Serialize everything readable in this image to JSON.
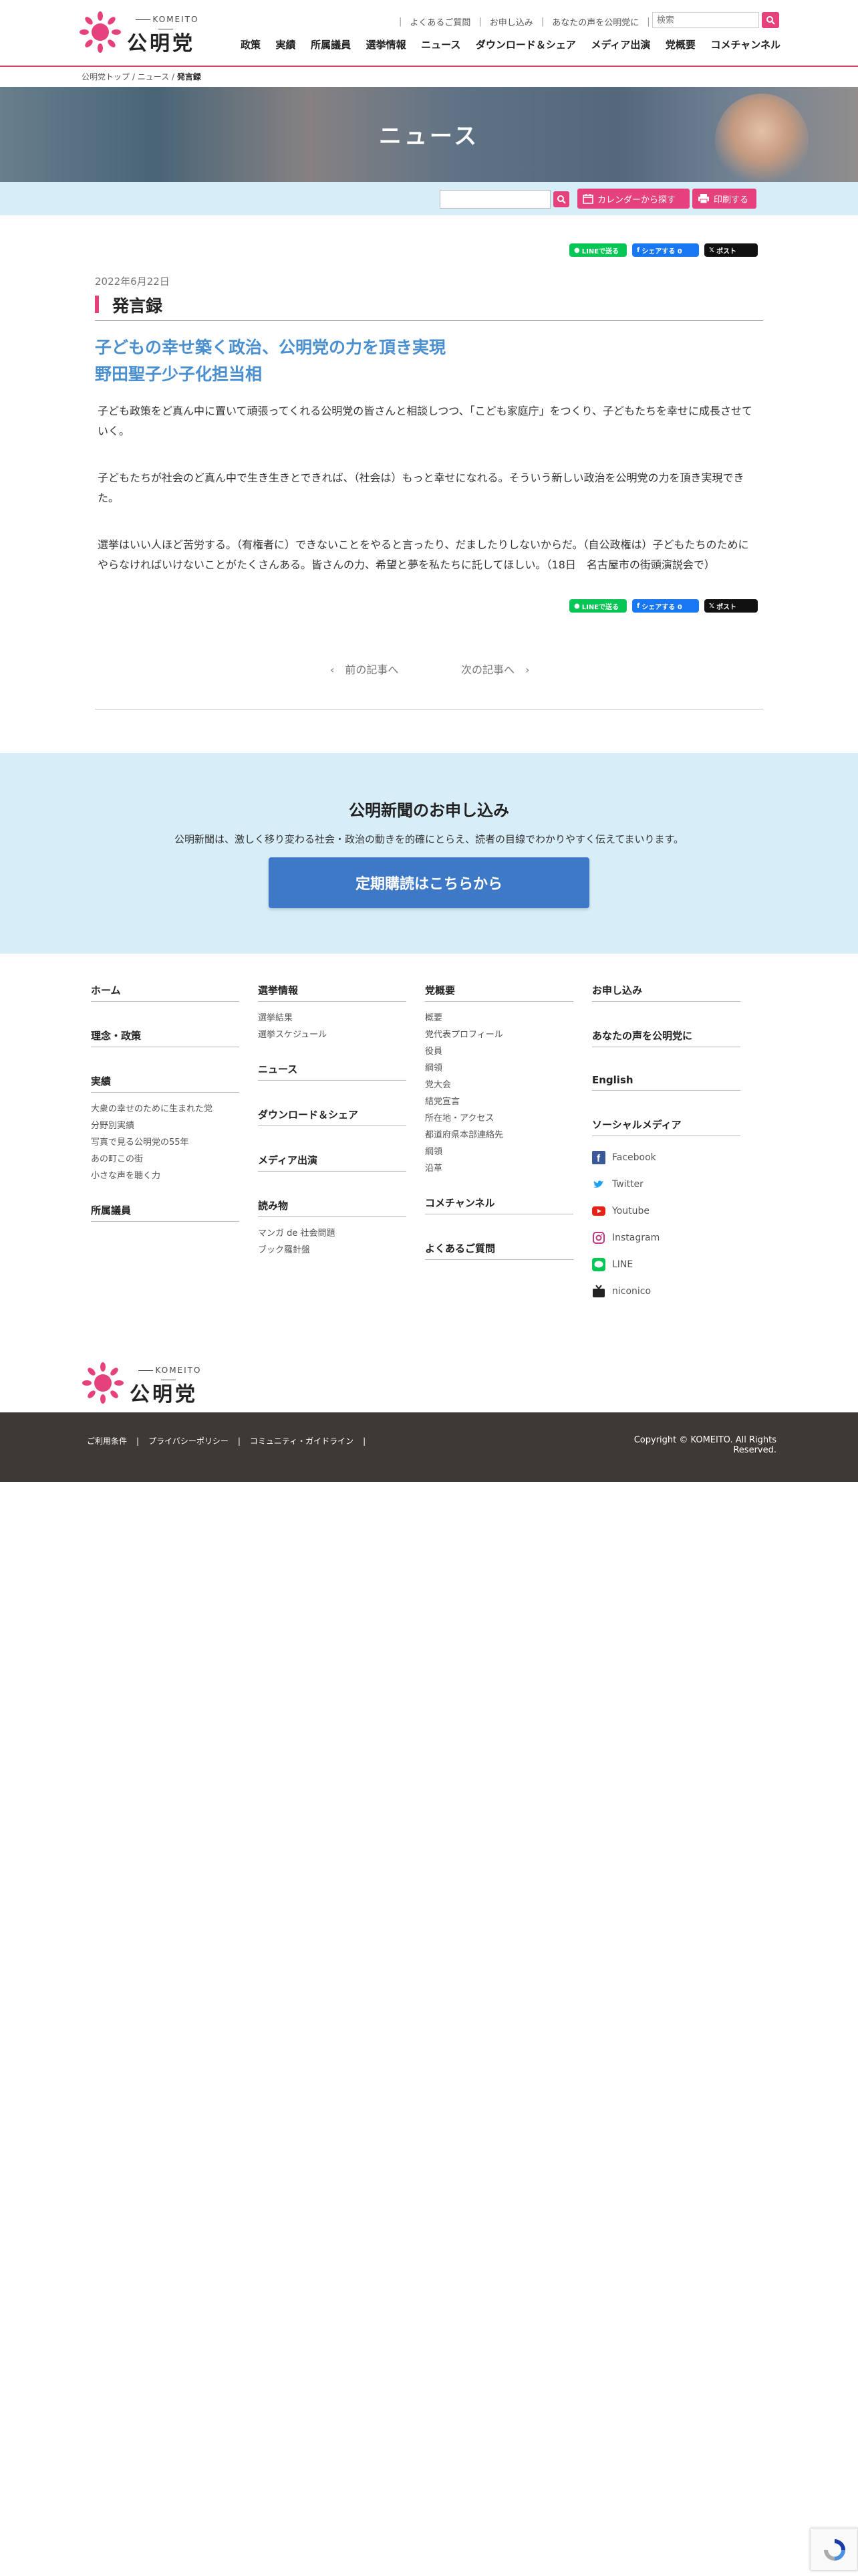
{
  "logo": {
    "en": "KOMEITO",
    "jp": "公明党"
  },
  "util_links": [
    "よくあるご質問",
    "お申し込み",
    "あなたの声を公明党に"
  ],
  "search": {
    "placeholder": "検索"
  },
  "main_nav": [
    "政策",
    "実績",
    "所属議員",
    "選挙情報",
    "ニュース",
    "ダウンロード＆シェア",
    "メディア出演",
    "党概要",
    "コメチャンネル"
  ],
  "breadcrumb": {
    "home": "公明党トップ",
    "sep": "/",
    "news": "ニュース",
    "current": "発言録"
  },
  "hero": {
    "title": "ニュース"
  },
  "toolbar": {
    "calendar_label": "カレンダーから探す",
    "print_label": "印刷する"
  },
  "share": {
    "line": "LINEで送る",
    "facebook": "シェアする 0",
    "x": "ポスト"
  },
  "article": {
    "date": "2022年6月22日",
    "category": "発言録",
    "title_line1": "子どもの幸せ築く政治、公明党の力を頂き実現",
    "title_line2": "野田聖子少子化担当相",
    "paragraphs": [
      "子ども政策をど真ん中に置いて頑張ってくれる公明党の皆さんと相談しつつ、「こども家庭庁」をつくり、子どもたちを幸せに成長させていく。",
      "子どもたちが社会のど真ん中で生き生きとできれば、（社会は）もっと幸せになれる。そういう新しい政治を公明党の力を頂き実現できた。",
      "選挙はいい人ほど苦労する。（有権者に）できないことをやると言ったり、だましたりしないからだ。（自公政権は）子どもたちのためにやらなければいけないことがたくさんある。皆さんの力、希望と夢を私たちに託してほしい。（18日　名古屋市の街頭演説会で）"
    ]
  },
  "pager": {
    "prev": "‹　前の記事へ",
    "next": "次の記事へ　›"
  },
  "subscribe": {
    "title": "公明新聞のお申し込み",
    "text": "公明新聞は、激しく移り変わる社会・政治の動きを的確にとらえ、読者の目線でわかりやすく伝えてまいります。",
    "button": "定期購読はこちらから"
  },
  "footer": {
    "col1": {
      "home": "ホーム",
      "policy": "理念・政策",
      "results": "実績",
      "results_links": [
        "大衆の幸せのために生まれた党",
        "分野別実績",
        "写真で見る公明党の55年",
        "あの町この街",
        "小さな声を聴く力"
      ],
      "members": "所属議員"
    },
    "col2": {
      "election": "選挙情報",
      "election_links": [
        "選挙結果",
        "選挙スケジュール"
      ],
      "news": "ニュース",
      "download": "ダウンロード＆シェア",
      "media": "メディア出演",
      "reading": "読み物",
      "reading_links": [
        "マンガ de 社会問題",
        "ブック羅針盤"
      ]
    },
    "col3": {
      "about": "党概要",
      "about_links": [
        "概要",
        "党代表プロフィール",
        "役員",
        "綱領",
        "党大会",
        "結党宣言",
        "所在地・アクセス",
        "都道府県本部連絡先",
        "綱領",
        "沿革"
      ],
      "channel": "コメチャンネル",
      "faq": "よくあるご質問"
    },
    "col4": {
      "apply": "お申し込み",
      "voice": "あなたの声を公明党に",
      "english": "English",
      "social": "ソーシャルメディア",
      "social_links": [
        "Facebook",
        "Twitter",
        "Youtube",
        "Instagram",
        "LINE",
        "niconico"
      ]
    }
  },
  "legal": [
    "ご利用条件",
    "プライバシーポリシー",
    "コミュニティ・ガイドライン"
  ],
  "copyright": "Copyright © KOMEITO. All Rights Reserved.",
  "colors": {
    "accent": "#e5417c",
    "link_blue": "#4a8fd0",
    "band": "#d7eef9",
    "button_blue": "#3d79c7",
    "footer_dark": "#3f3936"
  }
}
